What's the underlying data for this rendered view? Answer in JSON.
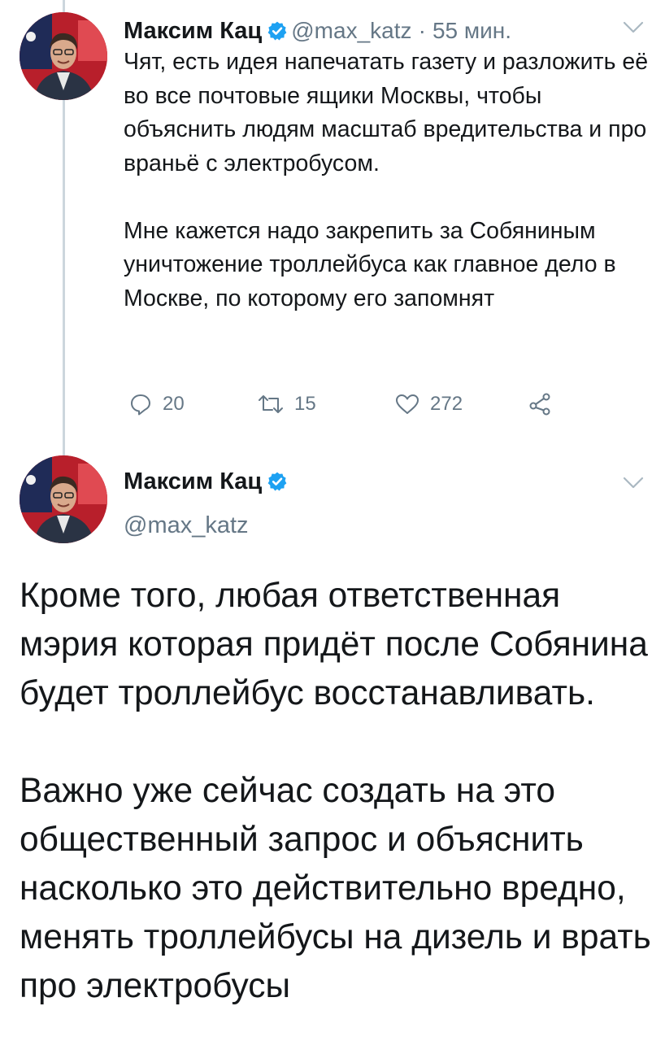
{
  "tweet1": {
    "author_name": "Максим Кац",
    "handle": "@max_katz",
    "separator": "·",
    "time": "55 мин.",
    "paragraphs": [
      "Чят, есть идея напечатать газету и разложить её во все почтовые ящики Москвы, чтобы объяснить людям масштаб вредительства и про враньё с электробусом.",
      "Мне кажется надо закрепить за Собяниным уничтожение троллейбуса как главное дело в Москве, по которому его запомнят"
    ],
    "actions": {
      "reply": {
        "icon": "reply-icon",
        "count": "20"
      },
      "retweet": {
        "icon": "retweet-icon",
        "count": "15"
      },
      "like": {
        "icon": "heart-icon",
        "count": "272"
      },
      "share": {
        "icon": "share-icon"
      }
    }
  },
  "tweet2": {
    "author_name": "Максим Кац",
    "handle": "@max_katz",
    "paragraphs": [
      "Кроме того, любая ответственная мэрия которая придёт после Собянина будет троллейбус восстанавливать.",
      "Важно уже сейчас создать на это общественный запрос и объяснить насколько это действительно вредно, менять троллейбусы на дизель и врать про электробусы"
    ]
  },
  "colors": {
    "text": "#14171a",
    "secondary": "#657786",
    "verified": "#1da1f2",
    "thread_line": "#ccd6dd",
    "chevron": "#aab8c2"
  }
}
